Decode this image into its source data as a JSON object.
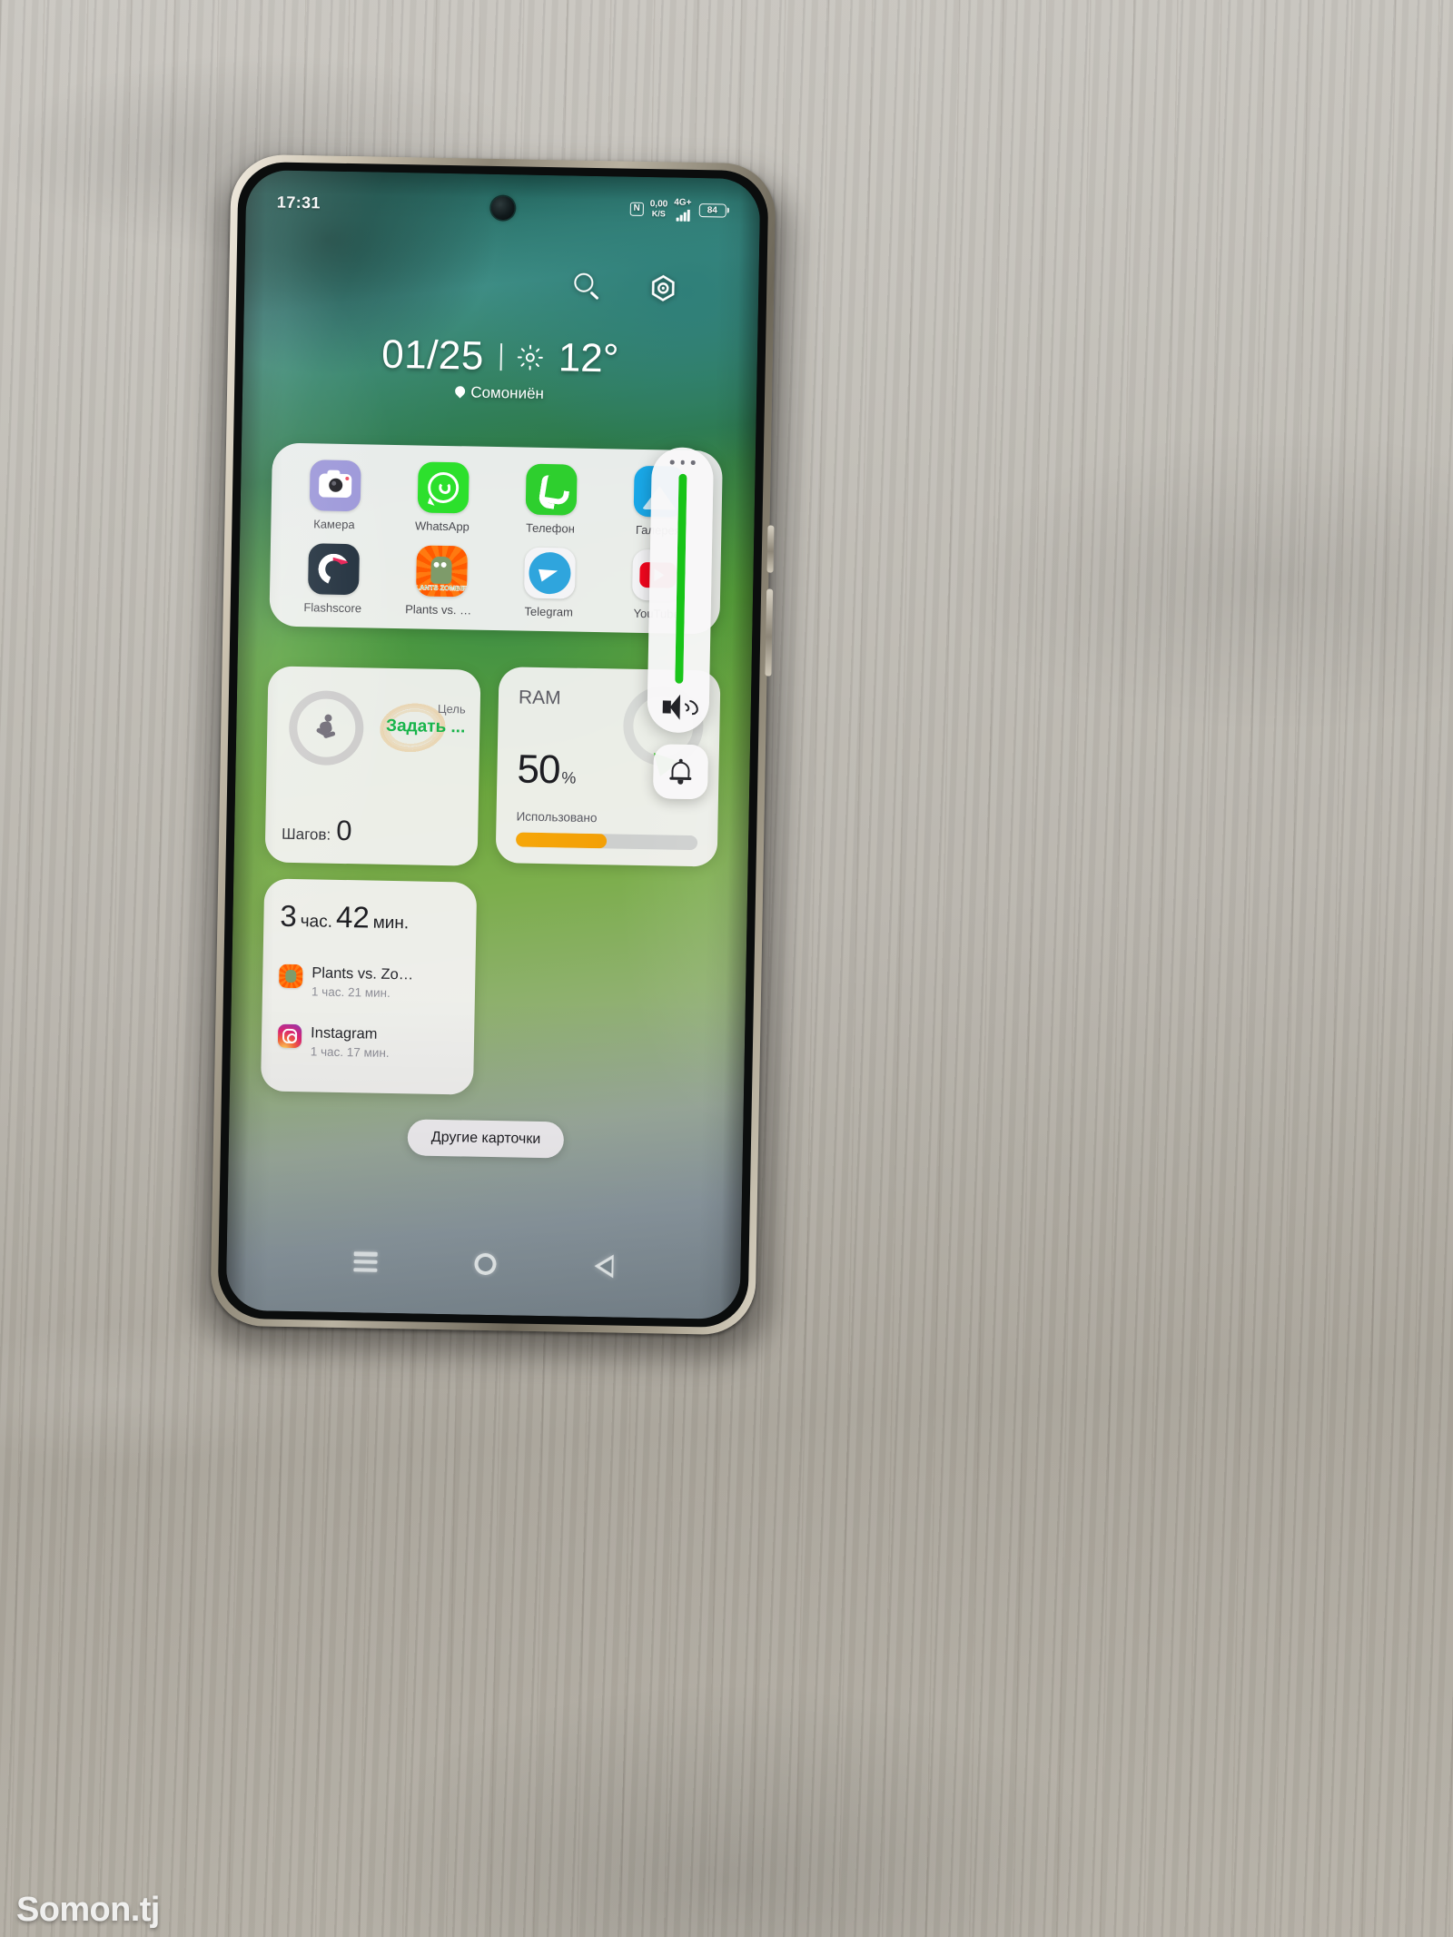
{
  "watermark": {
    "text": "Somon.tj"
  },
  "statusbar": {
    "time": "17:31",
    "nfc_glyph": "N",
    "net_speed_value": "0,00",
    "net_speed_unit": "K/S",
    "network_type": "4G+",
    "battery_level": "84"
  },
  "topbar": {
    "search_icon": "search-icon",
    "settings_icon": "hex-gear-icon"
  },
  "datewidget": {
    "date": "01/25",
    "weather_icon": "sun-icon",
    "temperature": "12°",
    "location": "Сомониён",
    "location_icon": "map-pin-icon"
  },
  "apps": {
    "row1": [
      {
        "label": "Камера",
        "icon": "camera-icon"
      },
      {
        "label": "WhatsApp",
        "icon": "whatsapp-icon"
      },
      {
        "label": "Телефон",
        "icon": "phone-icon"
      },
      {
        "label": "Галерея",
        "icon": "gallery-icon"
      }
    ],
    "row2": [
      {
        "label": "Flashscore",
        "icon": "flashscore-icon"
      },
      {
        "label": "Plants vs. Zo…",
        "icon": "plants-vs-zombies-icon"
      },
      {
        "label": "Telegram",
        "icon": "telegram-icon"
      },
      {
        "label": "YouTube",
        "icon": "youtube-icon"
      }
    ]
  },
  "volume_panel": {
    "more_icon": "three-dots-icon",
    "level_percent": 100,
    "speaker_icon": "speaker-volume-icon",
    "bell_icon": "bell-ringer-icon"
  },
  "steps_widget": {
    "runner_icon": "runner-icon",
    "goal_label": "Цель",
    "goal_action": "Задать ...",
    "steps_label": "Шагов:",
    "steps_value": "0",
    "goal_color": "#17b44a"
  },
  "ram_widget": {
    "title": "RAM",
    "percent_value": "50",
    "percent_sign": "%",
    "used_label": "Использовано",
    "bar_percent": 50,
    "bar_color": "#f3a007"
  },
  "screen_time_widget": {
    "total_hours": "3",
    "total_hours_word": "час.",
    "total_minutes": "42",
    "total_minutes_word": "мин.",
    "apps": [
      {
        "name": "Plants vs. Zo…",
        "time": "1 час. 21 мин.",
        "icon": "plants-vs-zombies-icon"
      },
      {
        "name": "Instagram",
        "time": "1 час. 17 мин.",
        "icon": "instagram-icon"
      }
    ]
  },
  "more_cards_button": {
    "label": "Другие карточки"
  },
  "navbar": {
    "recents_icon": "recents-menu-icon",
    "home_icon": "home-circle-icon",
    "back_icon": "back-triangle-icon"
  }
}
